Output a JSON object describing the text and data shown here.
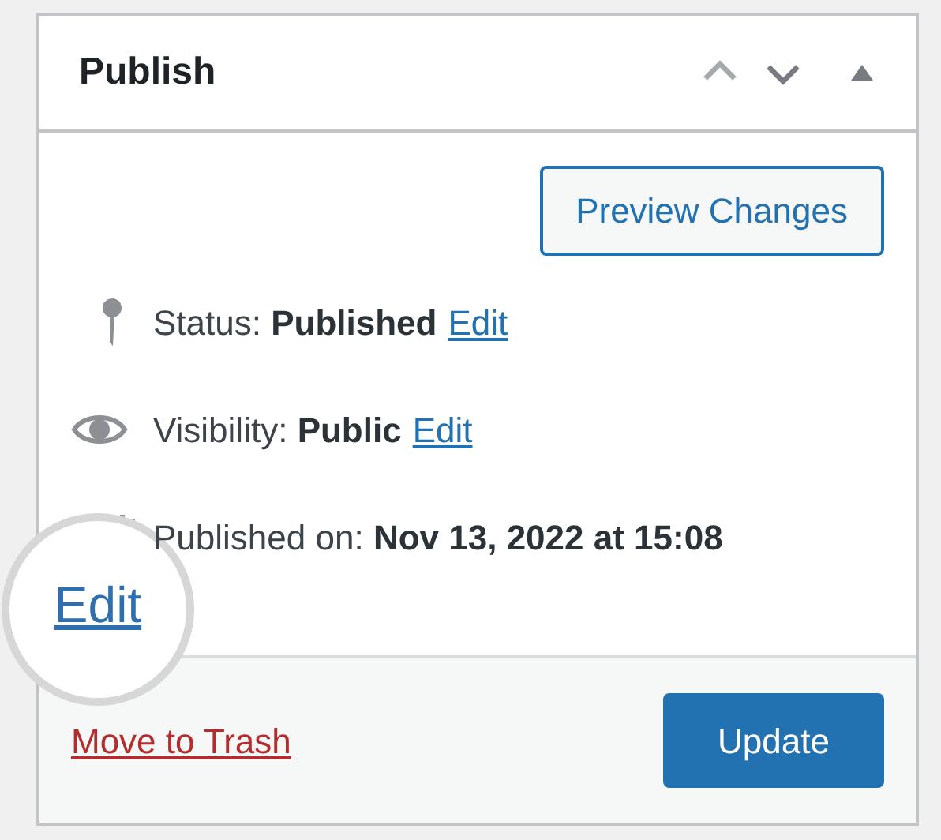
{
  "panel": {
    "title": "Publish",
    "order_buttons": [
      {
        "kind": "up",
        "disabled": true
      },
      {
        "kind": "down",
        "disabled": false
      }
    ],
    "expanded": true
  },
  "preview_button": "Preview Changes",
  "rows": [
    {
      "kind": "status",
      "label": "Status:",
      "value": "Published",
      "link": "Edit"
    },
    {
      "kind": "visibility",
      "label": "Visibility:",
      "value": "Public",
      "link": "Edit"
    },
    {
      "kind": "date",
      "label": "Published on:",
      "value": "Nov 13, 2022 at 15:08"
    }
  ],
  "magnified_link": "Edit",
  "footer": {
    "trash_link": "Move to Trash",
    "update_button": "Update"
  }
}
